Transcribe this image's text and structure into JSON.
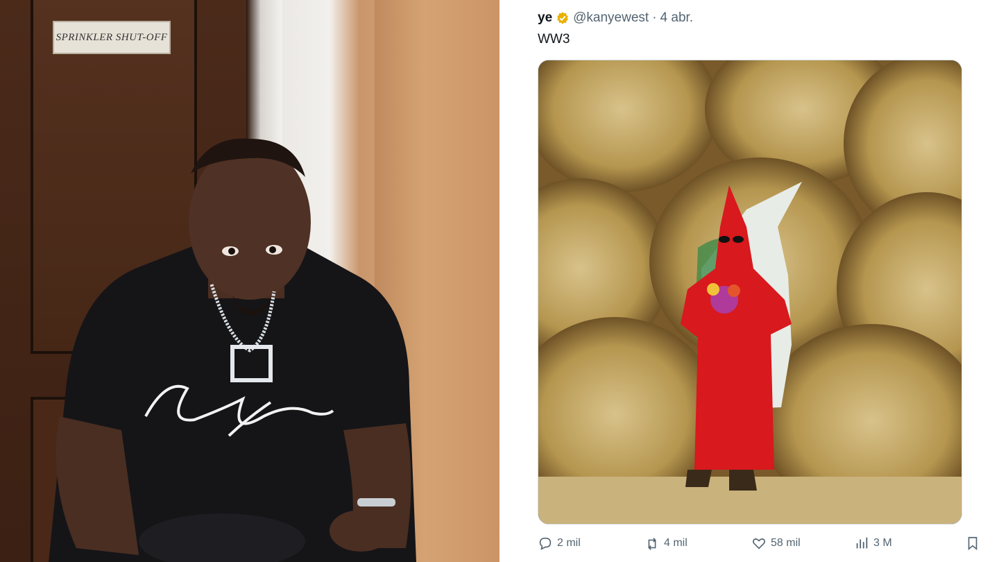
{
  "left_photo": {
    "door_sign": "SPRINKLER SHUT-OFF"
  },
  "tweet": {
    "name": "ye",
    "handle": "@kanyewest",
    "dot": "·",
    "date": "4 abr.",
    "text": "WW3",
    "actions": {
      "replies": "2 mil",
      "reposts": "4 mil",
      "likes": "58 mil",
      "views": "3 M"
    }
  },
  "colors": {
    "verified": "#e8b100",
    "text": "#0f1419",
    "muted": "#536471"
  },
  "icons": [
    "verified-badge-icon",
    "reply-icon",
    "repost-icon",
    "like-icon",
    "views-icon",
    "bookmark-icon"
  ]
}
